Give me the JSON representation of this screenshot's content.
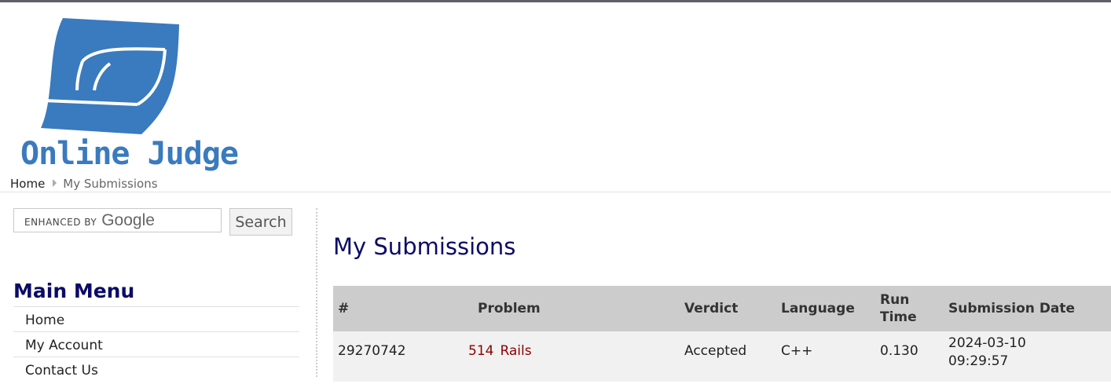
{
  "header": {
    "logo_text": "Online Judge",
    "logo_color": "#3a7abf",
    "breadcrumb": {
      "home": "Home",
      "current": "My Submissions"
    }
  },
  "sidebar": {
    "search": {
      "branding_prefix": "ENHANCED BY",
      "branding_name": "Google",
      "button_label": "Search"
    },
    "menu_title": "Main Menu",
    "menu_items": [
      {
        "label": "Home"
      },
      {
        "label": "My Account"
      },
      {
        "label": "Contact Us"
      }
    ]
  },
  "main": {
    "title": "My Submissions",
    "table": {
      "columns": {
        "id": "#",
        "problem": "Problem",
        "verdict": "Verdict",
        "language": "Language",
        "run_time_line1": "Run",
        "run_time_line2": "Time",
        "date": "Submission Date"
      },
      "rows": [
        {
          "id": "29270742",
          "problem_number": "514",
          "problem_name": "Rails",
          "verdict": "Accepted",
          "language": "C++",
          "run_time": "0.130",
          "date": "2024-03-10",
          "time": "09:29:57"
        }
      ]
    }
  },
  "colors": {
    "title_navy": "#0b0b66",
    "problem_link": "#8b0000",
    "table_header_bg": "#cccccc"
  }
}
